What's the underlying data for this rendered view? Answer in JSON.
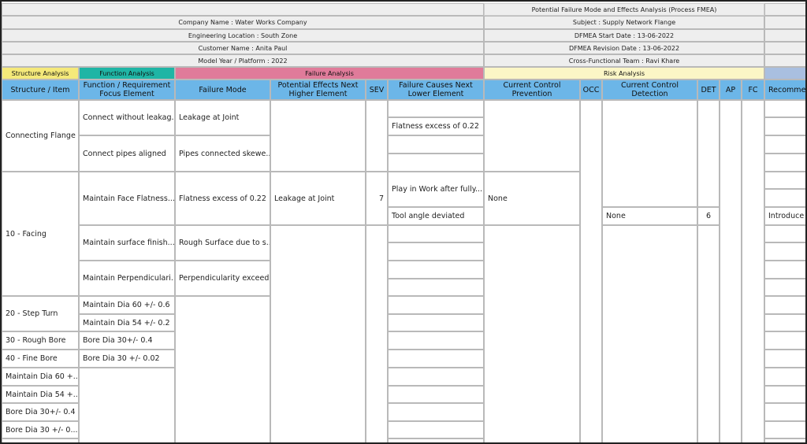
{
  "header": {
    "report_title": "Potential Failure Mode and Effects Analysis (Process FMEA)",
    "company": "Company Name : Water Works Company",
    "subject": "Subject : Supply Network Flange",
    "location": "Engineering Location : South Zone",
    "start_date": "DFMEA Start Date : 13-06-2022",
    "customer": "Customer Name : Anita Paul",
    "revision_date": "DFMEA Revision Date : 13-06-2022",
    "model_year": "Model Year / Platform : 2022",
    "team": "Cross-Functional Team : Ravi Khare"
  },
  "bands": {
    "structure": "Structure Analysis",
    "function": "Function Analysis",
    "failure": "Failure Analysis",
    "risk": "Risk Analysis"
  },
  "columns": {
    "structure": "Structure / Item",
    "function": "Function / Requirement Focus Element",
    "failure_mode": "Failure Mode",
    "effects": "Potential Effects Next Higher Element",
    "sev": "SEV",
    "causes": "Failure Causes Next Lower Element",
    "prevention": "Current Control Prevention",
    "occ": "OCC",
    "detection": "Current Control Detection",
    "det": "DET",
    "ap": "AP",
    "fc": "FC",
    "recommended": "Recomme"
  },
  "colors": {
    "structure_band": "#f5e97a",
    "function_band": "#1fb5a5",
    "failure_band": "#e07b9a",
    "risk_band": "#fbf6c6",
    "column_header": "#6cb6e8",
    "meta_row": "#eeeeee"
  },
  "rows": {
    "struct_1": "Connecting Flange",
    "struct_2": "10 - Facing",
    "struct_3": "20 - Step Turn",
    "struct_4": "30 - Rough Bore",
    "struct_5": "40 - Fine Bore",
    "struct_6": "Maintain Dia 60 +...",
    "struct_7": "Maintain Dia 54 +...",
    "struct_8": "Bore Dia 30+/- 0.4",
    "struct_9": "Bore Dia 30 +/- 0...",
    "func_1": "Connect without leakag...",
    "func_2": "Connect pipes aligned",
    "func_3": "Maintain Face Flatness...",
    "func_4": "Maintain surface finish...",
    "func_5": "Maintain Perpendiculari...",
    "func_6": "Maintain Dia 60 +/- 0.6",
    "func_7": "Maintain Dia 54 +/- 0.2",
    "func_8": "Bore Dia 30+/- 0.4",
    "func_9": "Bore Dia 30 +/- 0.02",
    "fm_1": "Leakage at Joint",
    "fm_2": "Pipes connected skewe...",
    "fm_3": "Flatness excess of 0.22",
    "fm_4": "Rough Surface due to s...",
    "fm_5": "Perpendicularity exceed...",
    "effect_1": "Leakage at Joint",
    "sev_1": "7",
    "cause_1": "Flatness excess of 0.22",
    "cause_2": "Play in Work after fully...",
    "cause_3": "Tool angle deviated",
    "prevention_1": "None",
    "detection_1": "None",
    "det_1": "6",
    "recommended_1": "Introduce T"
  }
}
